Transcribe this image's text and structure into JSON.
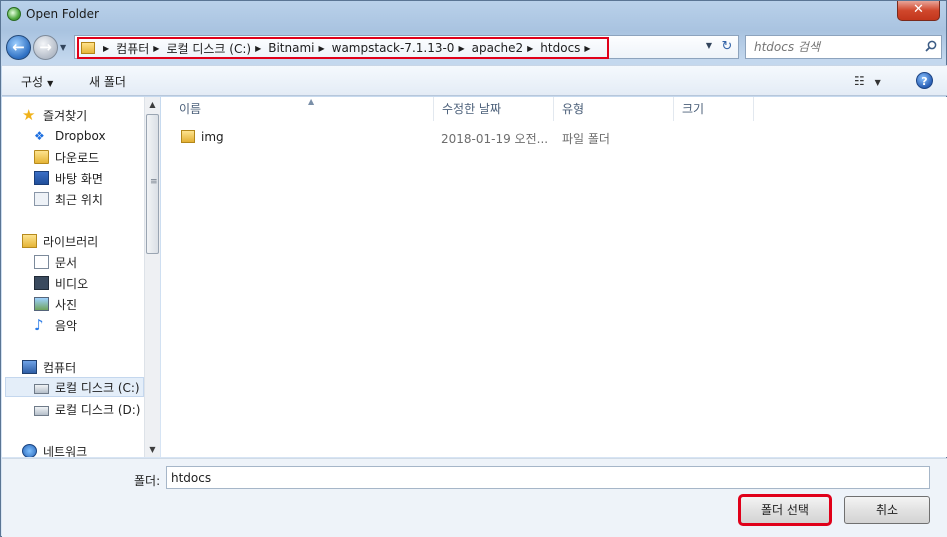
{
  "window": {
    "title": "Open Folder",
    "close_label": "✕"
  },
  "address": {
    "crumbs": [
      "컴퓨터",
      "로컬 디스크 (C:)",
      "Bitnami",
      "wampstack-7.1.13-0",
      "apache2",
      "htdocs"
    ]
  },
  "search": {
    "placeholder": "htdocs 검색"
  },
  "toolbar": {
    "organize_label": "구성",
    "new_folder_label": "새 폴더"
  },
  "nav": {
    "favorites": "즐겨찾기",
    "dropbox": "Dropbox",
    "downloads": "다운로드",
    "desktop": "바탕 화면",
    "recent": "최근 위치",
    "libraries": "라이브러리",
    "documents": "문서",
    "videos": "비디오",
    "pictures": "사진",
    "music": "음악",
    "computer": "컴퓨터",
    "drive_c": "로컬 디스크 (C:)",
    "drive_d": "로컬 디스크 (D:)",
    "network": "네트워크"
  },
  "columns": {
    "name": "이름",
    "date": "수정한 날짜",
    "type": "유형",
    "size": "크기"
  },
  "files": [
    {
      "name": "img",
      "date": "2018-01-19 오전...",
      "type": "파일 폴더",
      "size": ""
    }
  ],
  "footer": {
    "folder_label": "폴더:",
    "folder_value": "htdocs",
    "select_button": "폴더 선택",
    "cancel_button": "취소"
  },
  "colors": {
    "highlight_border": "#e0001a",
    "selected_nav_bg": "#e4eef9"
  }
}
